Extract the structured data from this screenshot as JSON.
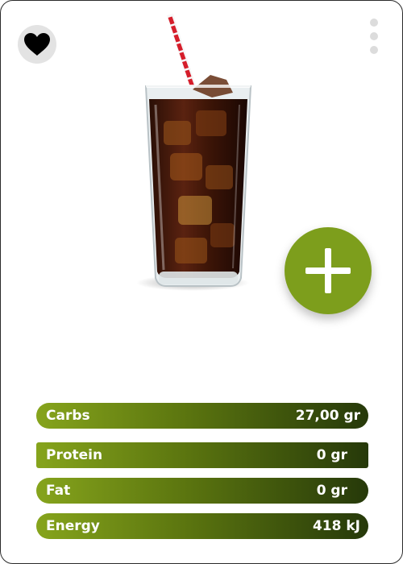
{
  "favorite": {
    "icon": "heart-icon"
  },
  "menu": {
    "icon": "more-vertical-icon"
  },
  "product": {
    "image": "cola-glass-with-ice-and-straw",
    "name": "",
    "subtitle": ""
  },
  "add": {
    "icon": "plus-icon",
    "color": "#7d9e1c"
  },
  "nutrition": [
    {
      "label": "Carbs",
      "value": "27,00 gr"
    },
    {
      "label": "Protein",
      "value": "0 gr"
    },
    {
      "label": "Fat",
      "value": "0 gr"
    },
    {
      "label": "Energy",
      "value": "418 kJ"
    }
  ],
  "colors": {
    "accent": "#7d9e1c",
    "bar_start": "#86a41c",
    "bar_end": "#26390a"
  }
}
